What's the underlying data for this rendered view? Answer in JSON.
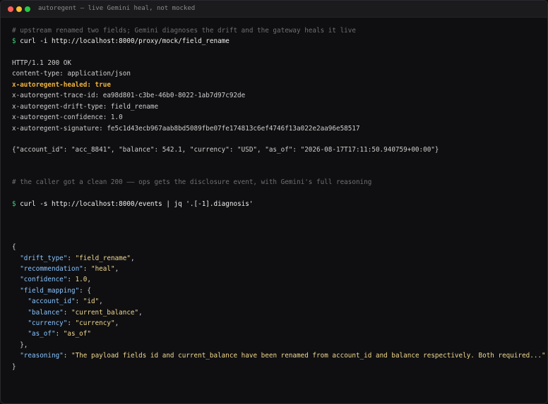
{
  "window": {
    "title": "autoregent — live Gemini heal, not mocked"
  },
  "terminal": {
    "prompt_symbol": "$",
    "comment_1": "# upstream renamed two fields; Gemini diagnoses the drift and the gateway heals it live",
    "command_1": "curl -i http://localhost:8000/proxy/mock/field_rename",
    "http_status": "HTTP/1.1 200 OK",
    "headers": {
      "content_type": "content-type: application/json",
      "healed": "x-autoregent-healed: true",
      "trace_id": "x-autoregent-trace-id: ea98d801-c3be-46b0-8022-1ab7d97c92de",
      "drift_type": "x-autoregent-drift-type: field_rename",
      "confidence": "x-autoregent-confidence: 1.0",
      "signature": "x-autoregent-signature: fe5c1d43ecb967aab8bd5089fbe07fe174813c6ef4746f13a022e2aa96e58517"
    },
    "response_body": "{\"account_id\": \"acc_8841\", \"balance\": 542.1, \"currency\": \"USD\", \"as_of\": \"2026-08-17T17:11:50.940759+00:00\"}",
    "comment_2": "# the caller got a clean 200 —— ops gets the disclosure event, with Gemini's full reasoning",
    "command_2": "curl -s http://localhost:8000/events | jq '.[-1].diagnosis'",
    "diagnosis": {
      "open_brace": "{",
      "drift_type_key": "\"drift_type\"",
      "drift_type_val": "\"field_rename\"",
      "recommendation_key": "\"recommendation\"",
      "recommendation_val": "\"heal\"",
      "confidence_key": "\"confidence\"",
      "confidence_val": "1.0",
      "field_mapping_key": "\"field_mapping\"",
      "mapping": [
        {
          "key": "\"account_id\"",
          "val": "\"id\"",
          "trail": ","
        },
        {
          "key": "\"balance\"",
          "val": "\"current_balance\"",
          "trail": ","
        },
        {
          "key": "\"currency\"",
          "val": "\"currency\"",
          "trail": ","
        },
        {
          "key": "\"as_of\"",
          "val": "\"as_of\"",
          "trail": ""
        }
      ],
      "mapping_close": "},",
      "reasoning_key": "\"reasoning\"",
      "reasoning_val": "\"The payload fields id and current_balance have been renamed from account_id and balance respectively. Both required...\"",
      "close_brace": "}"
    }
  }
}
